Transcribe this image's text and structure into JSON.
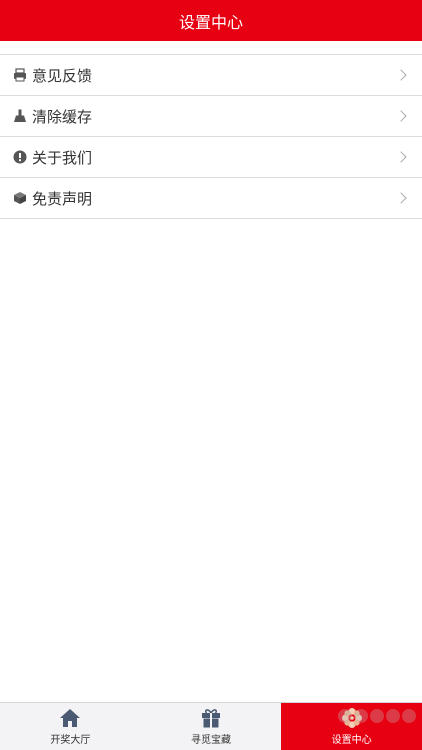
{
  "header": {
    "title": "设置中心"
  },
  "menu": {
    "items": [
      {
        "label": "意见反馈",
        "icon": "printer-icon"
      },
      {
        "label": "清除缓存",
        "icon": "broom-icon"
      },
      {
        "label": "关于我们",
        "icon": "exclamation-circle-icon"
      },
      {
        "label": "免责声明",
        "icon": "cube-icon"
      }
    ]
  },
  "tabbar": {
    "tabs": [
      {
        "label": "开奖大厅",
        "icon": "home-icon",
        "active": false
      },
      {
        "label": "寻觅宝藏",
        "icon": "gift-icon",
        "active": false
      },
      {
        "label": "设置中心",
        "icon": "flower-gear-icon",
        "active": true
      }
    ]
  },
  "colors": {
    "accent": "#e60012",
    "tabbar_bg": "#f3f3f5",
    "icon_gray": "#555555"
  }
}
